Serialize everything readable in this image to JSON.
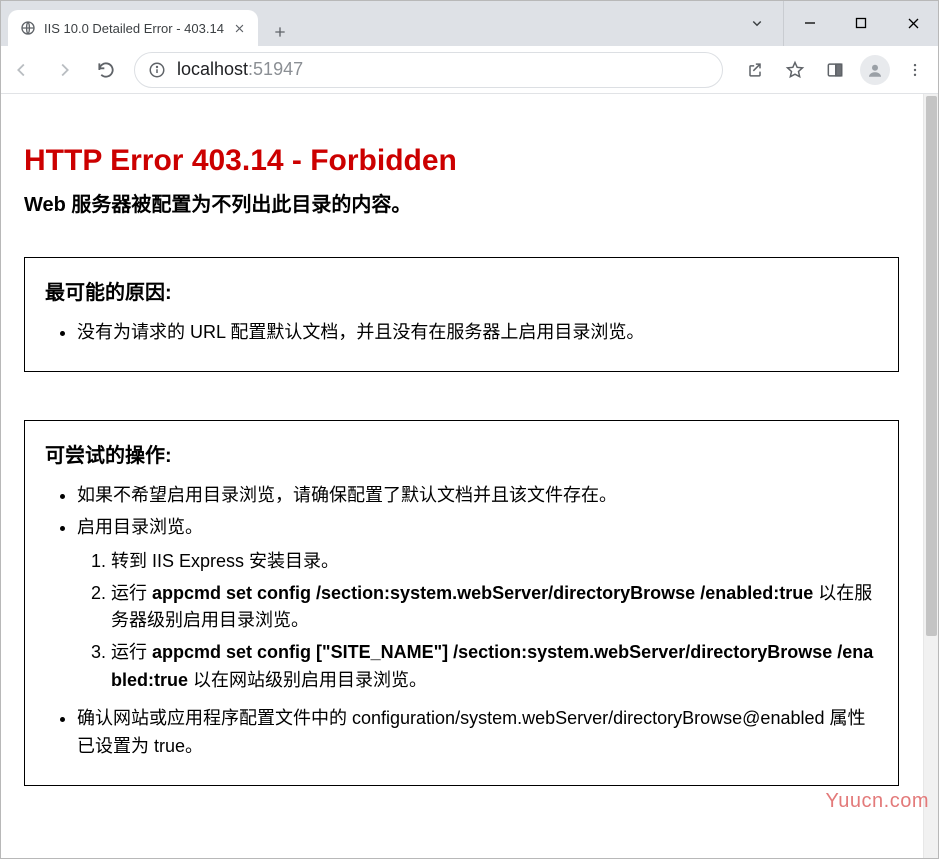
{
  "tab": {
    "title": "IIS 10.0 Detailed Error - 403.14",
    "url_host": "localhost",
    "url_port": ":51947"
  },
  "page": {
    "heading": "HTTP Error 403.14 - Forbidden",
    "subheading": "Web 服务器被配置为不列出此目录的内容。",
    "causes": {
      "title": "最可能的原因:",
      "items": [
        "没有为请求的 URL 配置默认文档，并且没有在服务器上启用目录浏览。"
      ]
    },
    "actions": {
      "title": "可尝试的操作:",
      "item1": "如果不希望启用目录浏览，请确保配置了默认文档并且该文件存在。",
      "item2": "启用目录浏览。",
      "steps": {
        "s1": "转到 IIS Express 安装目录。",
        "s2_prefix": "运行 ",
        "s2_cmd": "appcmd set config /section:system.webServer/directoryBrowse /enabled:true",
        "s2_suffix": " 以在服务器级别启用目录浏览。",
        "s3_prefix": "运行 ",
        "s3_cmd": "appcmd set config [\"SITE_NAME\"] /section:system.webServer/directoryBrowse /enabled:true",
        "s3_suffix": " 以在网站级别启用目录浏览。"
      },
      "item3": "确认网站或应用程序配置文件中的 configuration/system.webServer/directoryBrowse@enabled 属性已设置为 true。"
    }
  },
  "watermark": "Yuucn.com"
}
